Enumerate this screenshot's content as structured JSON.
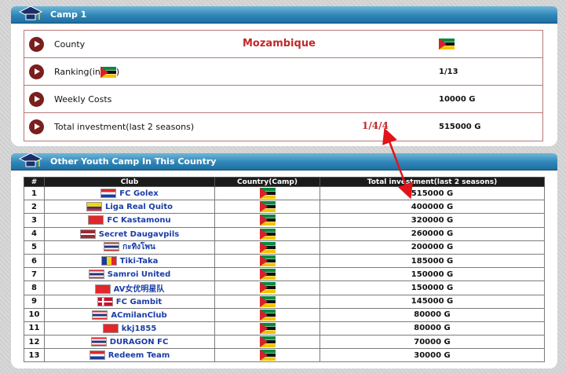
{
  "camp_panel": {
    "title": "Camp 1",
    "rows": [
      {
        "label": "County",
        "center": "Mozambique",
        "value": ""
      },
      {
        "label": "Ranking(in",
        "label_suffix": ")",
        "center": "",
        "value": "1/13"
      },
      {
        "label": "Weekly Costs",
        "center": "",
        "value": "10000 G"
      },
      {
        "label": "Total investment(last 2 seasons)",
        "center": "1/4/4",
        "value": "515000 G"
      }
    ]
  },
  "other_panel": {
    "title": "Other Youth Camp In This Country",
    "columns": [
      "#",
      "Club",
      "Country(Camp)",
      "Total investment(last 2 seasons)"
    ],
    "rows": [
      {
        "rank": "1",
        "club": "FC Golex",
        "flag": "croatia",
        "investment": "515000 G"
      },
      {
        "rank": "2",
        "club": "Liga Real Quito",
        "flag": "ecuador",
        "investment": "400000 G"
      },
      {
        "rank": "3",
        "club": "FC Kastamonu",
        "flag": "turkey",
        "investment": "320000 G"
      },
      {
        "rank": "4",
        "club": "Secret Daugavpils",
        "flag": "latvia",
        "investment": "260000 G"
      },
      {
        "rank": "5",
        "club": "กะทิงโพน",
        "flag": "thailand",
        "investment": "200000 G"
      },
      {
        "rank": "6",
        "club": "Tiki-Taka",
        "flag": "romania",
        "investment": "185000 G"
      },
      {
        "rank": "7",
        "club": "Samroi United",
        "flag": "thailand",
        "investment": "150000 G"
      },
      {
        "rank": "8",
        "club": "AV女优明星队",
        "flag": "china",
        "investment": "150000 G"
      },
      {
        "rank": "9",
        "club": "FC Gambit",
        "flag": "denmark",
        "investment": "145000 G"
      },
      {
        "rank": "10",
        "club": "ACmilanClub",
        "flag": "thailand",
        "investment": "80000 G"
      },
      {
        "rank": "11",
        "club": "kkj1855",
        "flag": "china",
        "investment": "80000 G"
      },
      {
        "rank": "12",
        "club": "DURAGON FC",
        "flag": "thailand",
        "investment": "70000 G"
      },
      {
        "rank": "13",
        "club": "Redeem Team",
        "flag": "croatia",
        "investment": "30000 G"
      }
    ]
  },
  "colors": {
    "header_blue": "#2f86b8",
    "accent_red": "#c0282a",
    "club_blue": "#1a3da8"
  }
}
